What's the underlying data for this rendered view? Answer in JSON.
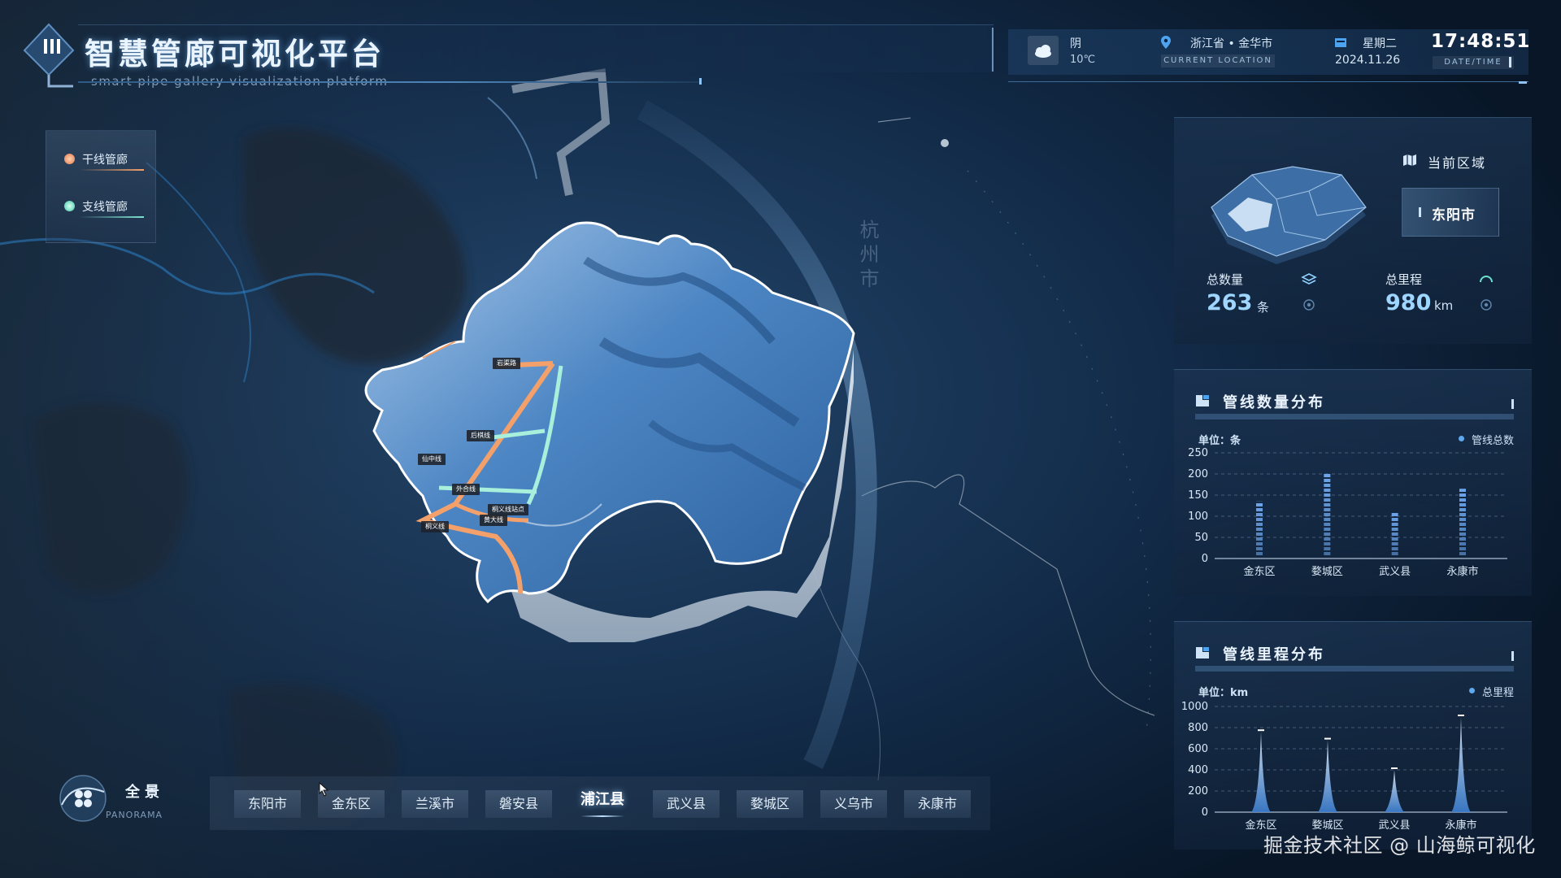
{
  "header": {
    "title": "智慧管廊可视化平台",
    "subtitle": "smart pipe gallery visualization platform",
    "weather": "阴",
    "temperature": "10℃",
    "location": "浙江省 • 金华市",
    "location_label": "CURRENT LOCATION",
    "weekday": "星期二",
    "date": "2024.11.26",
    "time": "17:48:51",
    "time_label": "DATE/TIME"
  },
  "legend": {
    "items": [
      {
        "label": "干线管廊",
        "color": "#f3a06a"
      },
      {
        "label": "支线管廊",
        "color": "#7fe3cf"
      }
    ]
  },
  "map": {
    "city_label": "杭州市",
    "pipe_labels": [
      "岩渠路",
      "后棋线",
      "仙中线",
      "外合线",
      "桐义线站点",
      "桐义线",
      "黄大线"
    ]
  },
  "region_panel": {
    "label": "当前区域",
    "current": "东阳市",
    "total_count_label": "总数量",
    "total_count": "263",
    "total_count_unit": "条",
    "total_length_label": "总里程",
    "total_length": "980",
    "total_length_unit": "km"
  },
  "count_panel": {
    "title": "管线数量分布",
    "unit": "单位：条",
    "series_label": "管线总数"
  },
  "length_panel": {
    "title": "管线里程分布",
    "unit": "单位：km",
    "series_label": "总里程"
  },
  "chart_data": [
    {
      "type": "bar",
      "title": "管线数量分布",
      "ylabel": "单位：条",
      "categories": [
        "金东区",
        "婺城区",
        "武义县",
        "永康市"
      ],
      "series": [
        {
          "name": "管线总数",
          "values": [
            135,
            200,
            110,
            165
          ]
        }
      ],
      "y_ticks": [
        0,
        50,
        100,
        150,
        200,
        250
      ],
      "ylim": [
        0,
        250
      ],
      "grid": true,
      "legend": "top-right"
    },
    {
      "type": "bar",
      "title": "管线里程分布",
      "ylabel": "单位：km",
      "categories": [
        "金东区",
        "婺城区",
        "武义县",
        "永康市"
      ],
      "series": [
        {
          "name": "总里程",
          "values": [
            760,
            680,
            400,
            900
          ]
        }
      ],
      "y_ticks": [
        0,
        200,
        400,
        600,
        800,
        1000
      ],
      "ylim": [
        0,
        1000
      ],
      "grid": true,
      "legend": "top-right"
    }
  ],
  "panorama": {
    "label": "全景",
    "sublabel": "PANORAMA"
  },
  "districts": {
    "items": [
      "东阳市",
      "金东区",
      "兰溪市",
      "磐安县",
      "浦江县",
      "武义县",
      "婺城区",
      "义乌市",
      "永康市"
    ],
    "active": "浦江县"
  },
  "watermark": "掘金技术社区 @ 山海鲸可视化",
  "colors": {
    "trunk": "#f3a06a",
    "branch": "#a8f0dc",
    "accent": "#5fa8f0",
    "bar": "#6fa8ef"
  }
}
